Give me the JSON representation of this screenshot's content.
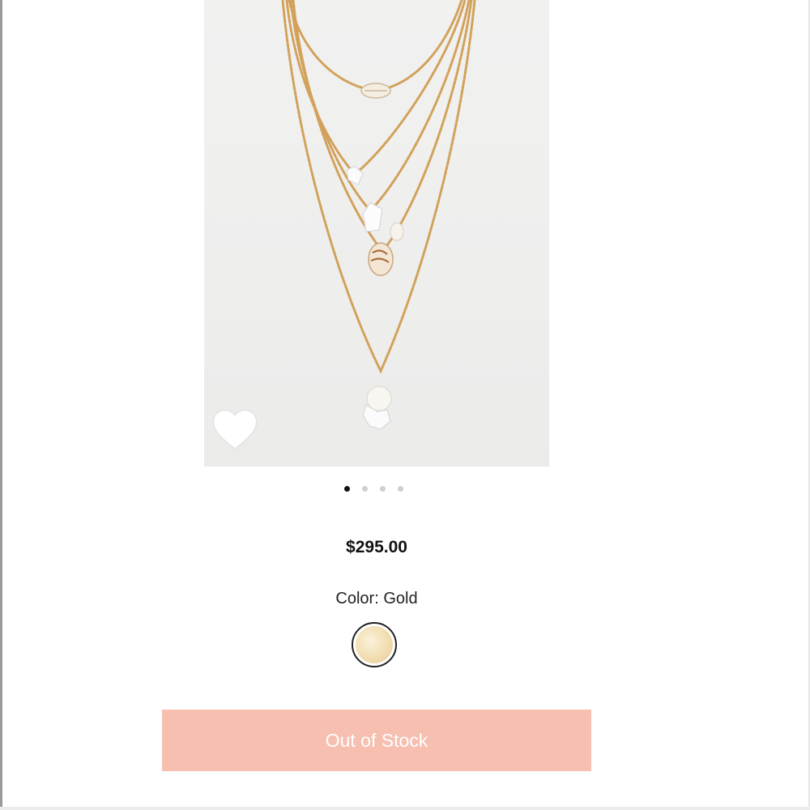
{
  "product": {
    "price": "$295.00",
    "color_label": "Color: Gold",
    "selected_color": "Gold",
    "stock_button_label": "Out of Stock"
  },
  "carousel": {
    "total": 4,
    "active_index": 0
  },
  "icons": {
    "favorite": "heart-icon"
  },
  "colors": {
    "button_bg": "#f6bfb0",
    "button_text": "#ffffff",
    "active_dot": "#111111",
    "inactive_dot": "#cfcfcf",
    "chain_gold": "#d2a15a"
  }
}
